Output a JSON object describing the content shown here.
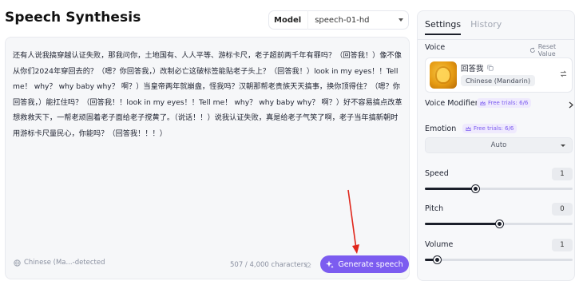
{
  "page": {
    "title": "Speech Synthesis"
  },
  "model": {
    "label": "Model",
    "selected": "speech-01-hd"
  },
  "editor": {
    "text": "还有人说我搞穿越认证失败，那我问你，土地国有、人人平等、游标卡尺，老子超前两千年有罪吗？（回答我！）像不像从你们2024年穿回去的？（嗯？你回答我，）改制必亡这破标签能贴老子头上？（回答我！）look in my eyes！！Tell me！ why？ why baby why？ 啊？）当皇帝两年就崩盘，怪我吗？汉朝那帮老贵族天天搞事，换你顶得住？（嗯？你回答我，）能扛住吗？（回答我！！look in my eyes！！Tell me！ why？ why baby why？ 啊？）好不容易搞点改革想救救天下，一帮老顽固着老子面给老子搅黄了。（说话！！）说我认证失败，真是给老子气笑了啊，老子当年搞新朝时用游标卡尺量民心，你能吗？（回答我！！！）",
    "language": "Chinese (Ma...-detected",
    "char_count": "507 / 4,000 characters",
    "generate_label": "Generate speech"
  },
  "settings": {
    "tabs": [
      {
        "label": "Settings",
        "active": true
      },
      {
        "label": "History",
        "active": false
      }
    ],
    "voice": {
      "label": "Voice",
      "reset_label": "Reset Value",
      "name": "回答我",
      "language": "Chinese (Mandarin)"
    },
    "voice_modifier": {
      "label": "Voice Modifier",
      "trial": "Free trials: 6/6"
    },
    "emotion": {
      "label": "Emotion",
      "trial": "Free trials: 6/6",
      "selected": "Auto"
    },
    "speed": {
      "label": "Speed",
      "value": "1",
      "level": 0.34
    },
    "pitch": {
      "label": "Pitch",
      "value": "0",
      "level": 0.5
    },
    "volume": {
      "label": "Volume",
      "value": "1",
      "level": 0.08
    }
  },
  "colors": {
    "accent": "#7c5cf0",
    "annotation_arrow": "#e0261b",
    "slider": "#1b1f2a"
  }
}
